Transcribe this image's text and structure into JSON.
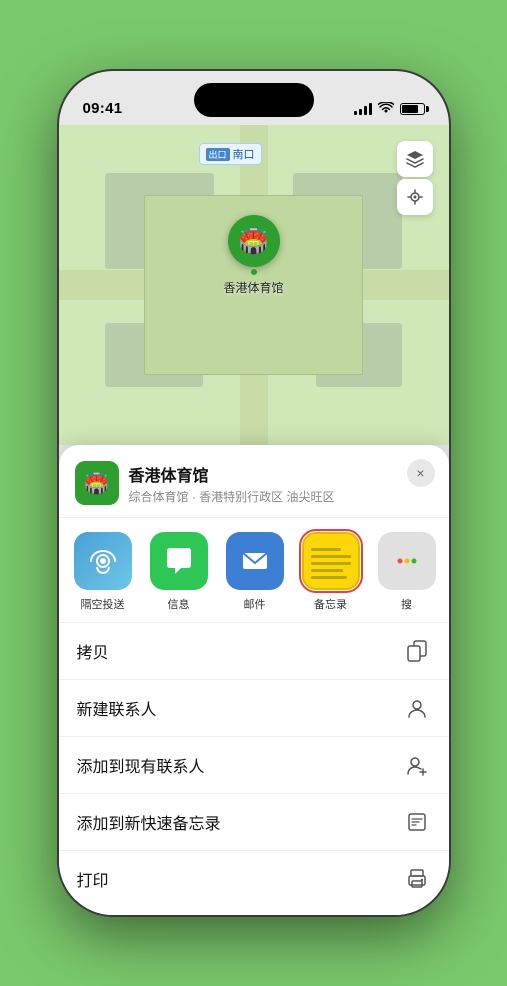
{
  "status_bar": {
    "time": "09:41",
    "signal": "●●●●",
    "wifi": "wifi",
    "battery": "battery"
  },
  "map": {
    "label_tag": "出口",
    "label_text": "南口",
    "controls": [
      "map-layers",
      "location"
    ]
  },
  "venue_pin": {
    "label": "香港体育馆",
    "emoji": "🏟️"
  },
  "venue_header": {
    "name": "香港体育馆",
    "subtitle": "综合体育馆 · 香港特别行政区 油尖旺区",
    "close_label": "×"
  },
  "share_items": [
    {
      "id": "airdrop",
      "label": "隔空投送",
      "selected": false
    },
    {
      "id": "messages",
      "label": "信息",
      "selected": false
    },
    {
      "id": "mail",
      "label": "邮件",
      "selected": false
    },
    {
      "id": "notes",
      "label": "备忘录",
      "selected": true
    },
    {
      "id": "more",
      "label": "搜",
      "selected": false
    }
  ],
  "action_rows": [
    {
      "id": "copy",
      "label": "拷贝",
      "icon": "copy"
    },
    {
      "id": "new-contact",
      "label": "新建联系人",
      "icon": "person"
    },
    {
      "id": "add-contact",
      "label": "添加到现有联系人",
      "icon": "person-add"
    },
    {
      "id": "quick-note",
      "label": "添加到新快速备忘录",
      "icon": "note"
    },
    {
      "id": "print",
      "label": "打印",
      "icon": "print"
    }
  ]
}
